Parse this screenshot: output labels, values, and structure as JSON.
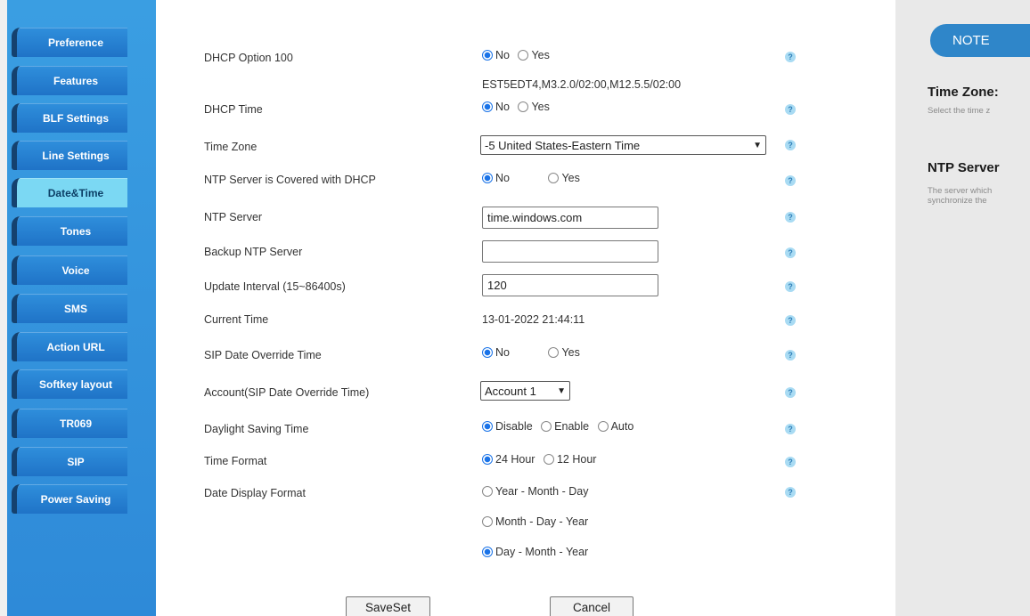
{
  "sidebar": {
    "items": [
      {
        "label": "Preference"
      },
      {
        "label": "Features"
      },
      {
        "label": "BLF Settings"
      },
      {
        "label": "Line Settings"
      },
      {
        "label": "Date&Time"
      },
      {
        "label": "Tones"
      },
      {
        "label": "Voice"
      },
      {
        "label": "SMS"
      },
      {
        "label": "Action URL"
      },
      {
        "label": "Softkey layout"
      },
      {
        "label": "TR069"
      },
      {
        "label": "SIP"
      },
      {
        "label": "Power Saving"
      }
    ],
    "active": "Date&Time"
  },
  "form": {
    "dhcp_option_100": {
      "label": "DHCP Option 100",
      "opt_no": "No",
      "opt_yes": "Yes",
      "selected": "No"
    },
    "dhcp_time_value": "EST5EDT4,M3.2.0/02:00,M12.5.5/02:00",
    "dhcp_time": {
      "label": "DHCP Time",
      "opt_no": "No",
      "opt_yes": "Yes",
      "selected": "No"
    },
    "time_zone": {
      "label": "Time Zone",
      "value": "-5 United States-Eastern Time"
    },
    "ntp_covered": {
      "label": "NTP Server is Covered with DHCP",
      "opt_no": "No",
      "opt_yes": "Yes",
      "selected": "No"
    },
    "ntp_server": {
      "label": "NTP Server",
      "value": "time.windows.com"
    },
    "backup_ntp": {
      "label": "Backup NTP Server",
      "value": ""
    },
    "update_interval": {
      "label": "Update Interval (15~86400s)",
      "value": "120"
    },
    "current_time": {
      "label": "Current Time",
      "value": "13-01-2022 21:44:11"
    },
    "sip_override": {
      "label": "SIP Date Override Time",
      "opt_no": "No",
      "opt_yes": "Yes",
      "selected": "No"
    },
    "account_override": {
      "label": "Account(SIP Date Override Time)",
      "value": "Account 1"
    },
    "dst": {
      "label": "Daylight Saving Time",
      "opt_disable": "Disable",
      "opt_enable": "Enable",
      "opt_auto": "Auto",
      "selected": "Disable"
    },
    "time_format": {
      "label": "Time Format",
      "opt_24": "24 Hour",
      "opt_12": "12 Hour",
      "selected": "24 Hour"
    },
    "date_format": {
      "label": "Date Display Format",
      "opt_ymd": "Year - Month - Day",
      "opt_mdy": "Month - Day - Year",
      "opt_dmy": "Day - Month - Year",
      "selected": "Day - Month - Year"
    },
    "help_glyph": "?",
    "save_label": "SaveSet",
    "cancel_label": "Cancel"
  },
  "note": {
    "tab_label": "NOTE",
    "tz_title": "Time Zone:",
    "tz_text": "Select the time z",
    "ntp_title": "NTP Server",
    "ntp_text_1": "The server which",
    "ntp_text_2": "synchronize the"
  },
  "colors": {
    "sidebar_blue": "#2e8ad8",
    "active_item": "#7bd8f3",
    "note_tab": "#2f86c9",
    "radio_selected": "#1a73e8"
  }
}
